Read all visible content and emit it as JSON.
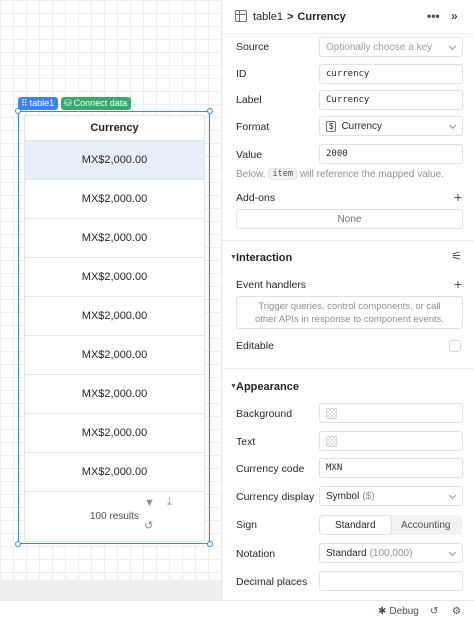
{
  "canvas": {
    "chips": {
      "table": "table1",
      "connect": "Connect data"
    },
    "table": {
      "header": "Currency",
      "rows": [
        "MX$2,000.00",
        "MX$2,000.00",
        "MX$2,000.00",
        "MX$2,000.00",
        "MX$2,000.00",
        "MX$2,000.00",
        "MX$2,000.00",
        "MX$2,000.00",
        "MX$2,000.00"
      ],
      "selected_row": 0,
      "footer_results": "100 results"
    }
  },
  "inspector": {
    "breadcrumb": {
      "parent": "table1",
      "separator": ">",
      "current": "Currency"
    },
    "source": {
      "label": "Source",
      "placeholder": "Optionally choose a key"
    },
    "id": {
      "label": "ID",
      "value": "currency"
    },
    "label": {
      "label": "Label",
      "value": "Currency"
    },
    "format": {
      "label": "Format",
      "value": "Currency"
    },
    "value": {
      "label": "Value",
      "value": "2000"
    },
    "hint": {
      "before": "Below,",
      "code": "item",
      "after": "will reference the mapped value."
    },
    "addons": {
      "label": "Add-ons",
      "none": "None"
    },
    "interaction": {
      "title": "Interaction"
    },
    "event_handlers": {
      "label": "Event handlers",
      "empty_line1": "Trigger queries, control components, or call",
      "empty_line2": "other APIs in response to component events."
    },
    "editable": {
      "label": "Editable"
    },
    "appearance": {
      "title": "Appearance"
    },
    "background": {
      "label": "Background"
    },
    "text": {
      "label": "Text"
    },
    "currency_code": {
      "label": "Currency code",
      "value": "MXN"
    },
    "currency_display": {
      "label": "Currency display",
      "value": "Symbol",
      "sub": "($)"
    },
    "sign": {
      "label": "Sign",
      "options": [
        "Standard",
        "Accounting"
      ],
      "selected": "Standard"
    },
    "notation": {
      "label": "Notation",
      "value": "Standard",
      "sub": "(100,000)"
    },
    "decimal_places": {
      "label": "Decimal places"
    }
  },
  "statusbar": {
    "debug": "Debug"
  }
}
